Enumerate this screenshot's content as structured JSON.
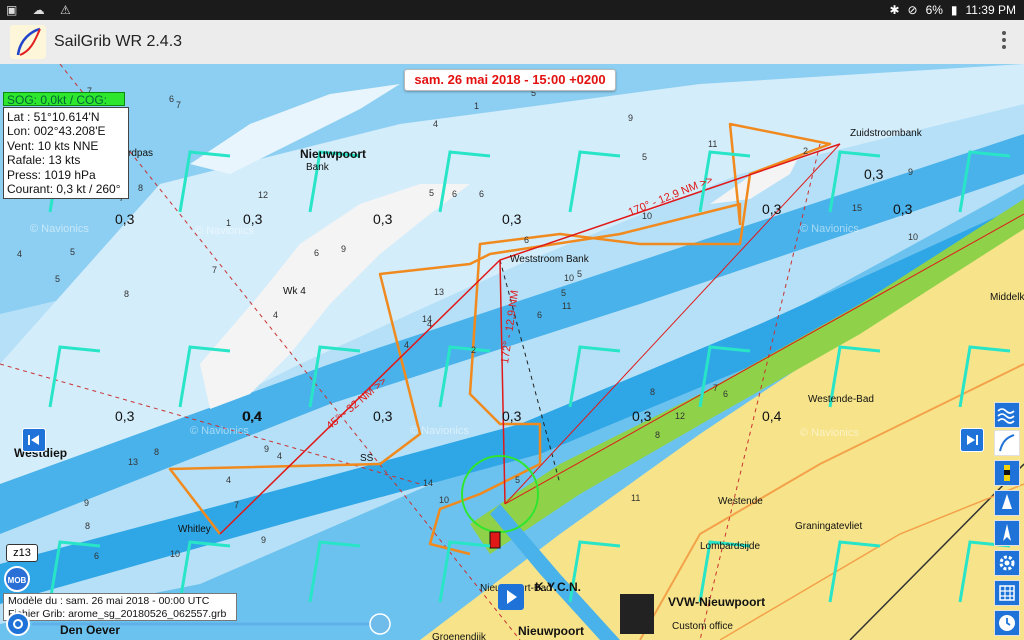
{
  "status_bar": {
    "left_icons": [
      "gallery-icon",
      "cloud-icon",
      "alert-icon"
    ],
    "battery": "6%",
    "time": "11:39 PM"
  },
  "app": {
    "title": "SailGrib WR 2.4.3"
  },
  "map": {
    "date_label": "sam. 26 mai 2018 - 15:00 +0200",
    "sog_label": "SOG: 0,0kt / COG:",
    "info": {
      "lat": "Lat :  51°10.614'N",
      "lon": "Lon: 002°43.208'E",
      "vent": "Vent:  10 kts  NNE",
      "rafale": "Rafale:  13 kts",
      "press": "Press: 1019 hPa",
      "courant": "Courant: 0,3 kt / 260°"
    },
    "model": {
      "line1": "Modèle du : sam. 26 mai 2018 - 00:00 UTC",
      "line2": "Fichier Grib: arome_sg_20180526_062557.grb"
    },
    "zoom": "z13",
    "mob": "MOB",
    "current_values": [
      "0,3",
      "0,3",
      "0,3",
      "0,3",
      "0,3",
      "0,3",
      "0,3",
      "0,3",
      "0,3",
      "0,4",
      "0,4",
      "0,3",
      "0,3",
      "0,4"
    ],
    "place_names": [
      "Nieuwpoort",
      "Bank",
      "rdpas",
      "Weststroom Bank",
      "Wk 4",
      "Westdiep",
      "Whitley",
      "Den Oever",
      "Westende-Bad",
      "Westende",
      "Lombardsijde",
      "Graningatevliet",
      "Nieuwpoort-Bad",
      "K.Y.C.N.",
      "Nieuwpoort",
      "VVW-Nieuwpoort",
      "Custom office",
      "Middelk",
      "Groenendijk",
      "Zuidstroombank",
      "SS"
    ],
    "route_labels": [
      "45° - 32 NM >>",
      "170° - 12,9 NM >>",
      "172° - 12,9 NM"
    ],
    "depths": [
      "2",
      "7",
      "4",
      "9",
      "10",
      "4",
      "9",
      "6",
      "5",
      "6",
      "7",
      "8",
      "9",
      "4",
      "10",
      "10",
      "5",
      "6",
      "8",
      "9",
      "8",
      "7",
      "6",
      "5",
      "6",
      "8",
      "4",
      "5",
      "8",
      "10",
      "14",
      "14",
      "13",
      "12",
      "11",
      "9",
      "7",
      "5",
      "6",
      "7",
      "8",
      "9",
      "4",
      "5",
      "6",
      "10",
      "11",
      "13",
      "15",
      "13",
      "12",
      "11",
      "4",
      "6",
      "7",
      "5",
      "2",
      "1",
      "4",
      "5",
      "1"
    ],
    "watermark": "© Navionics"
  },
  "controls": {
    "left_nav": "previous-button",
    "right_nav": "next-button"
  },
  "colors": {
    "deep": "#1e9de0",
    "mid": "#6cc2ee",
    "shallow": "#b8e1f8",
    "sand": "#f3f3f3",
    "land": "#f7e48a",
    "beach": "#8fd24a",
    "route": "#f08a1e",
    "track": "#e01818",
    "wind": "#28e5c8",
    "accent": "#1f73d8"
  }
}
